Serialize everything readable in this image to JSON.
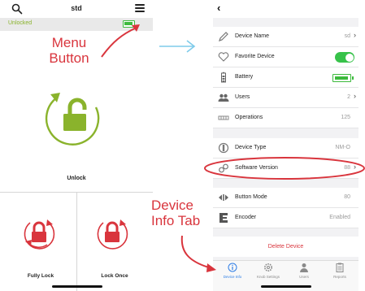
{
  "left_screen": {
    "title": "std",
    "status_text": "Unlocked",
    "big_action_label": "Unlock",
    "bottom_actions": [
      {
        "label": "Fully Lock"
      },
      {
        "label": "Lock Once"
      }
    ]
  },
  "right_screen": {
    "rows": [
      {
        "label": "Device Name",
        "value": "sd"
      },
      {
        "label": "Favorite Device",
        "value": ""
      },
      {
        "label": "Battery",
        "value": ""
      },
      {
        "label": "Users",
        "value": "2"
      },
      {
        "label": "Operations",
        "value": "125"
      },
      {
        "label": "Device Type",
        "value": "NM-O"
      },
      {
        "label": "Software Version",
        "value": "88"
      },
      {
        "label": "Button Mode",
        "value": "80"
      },
      {
        "label": "Encoder",
        "value": "Enabled"
      }
    ],
    "delete_label": "Delete Device",
    "tabs": [
      {
        "label": "Device Info",
        "icon": "info-icon"
      },
      {
        "label": "Knob Settings",
        "icon": "gear-icon"
      },
      {
        "label": "Users",
        "icon": "user-icon"
      },
      {
        "label": "Reports",
        "icon": "clipboard-icon"
      }
    ]
  },
  "annotations": {
    "menu_button_line1": "Menu",
    "menu_button_line2": "Button",
    "device_info_line1": "Device",
    "device_info_line2": "Info Tab"
  },
  "colors": {
    "accent_green": "#8ab32c",
    "annotation_red": "#d9353d",
    "transition_arrow": "#7ecbea",
    "toggle_on": "#37c24a",
    "active_tab": "#2f7ee6"
  }
}
